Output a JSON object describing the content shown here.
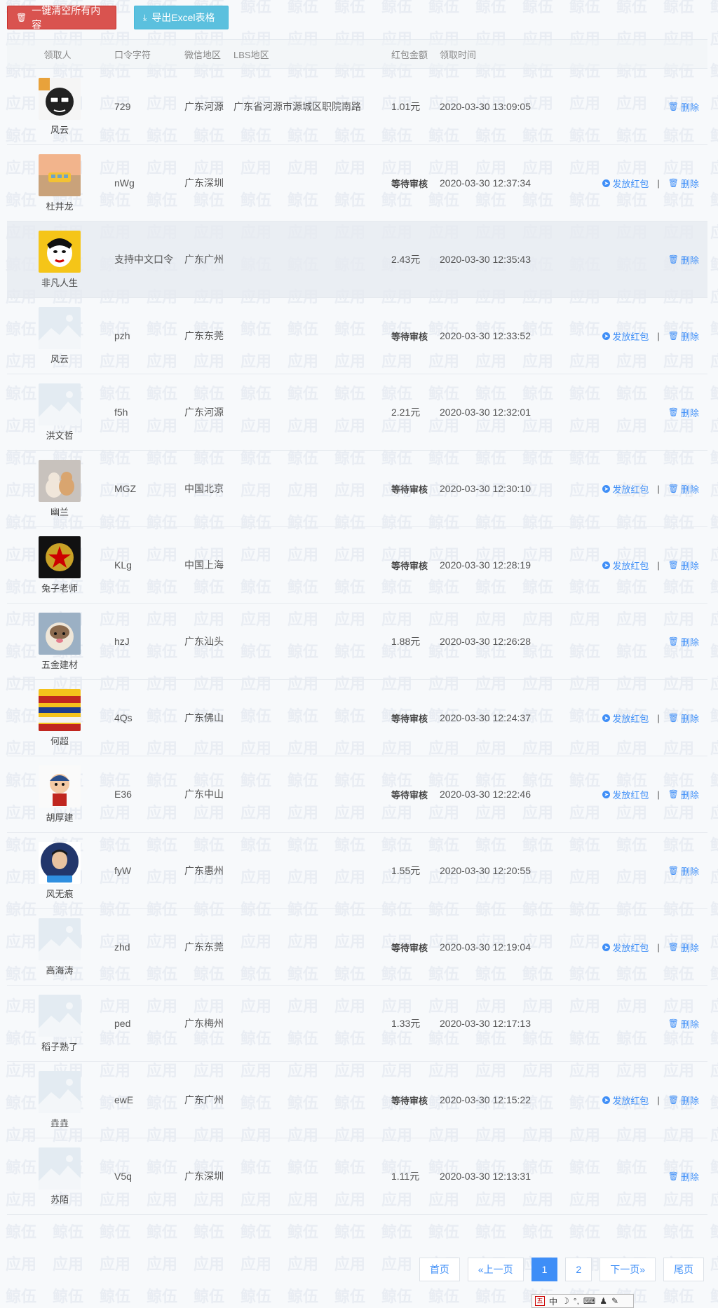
{
  "toolbar": {
    "clear_label": "一键清空所有内容",
    "clear_icon": "trash-icon",
    "export_label": "导出Excel表格",
    "export_icon": "download-icon"
  },
  "table": {
    "headers": {
      "user": "领取人",
      "code": "口令字符",
      "wx_region": "微信地区",
      "lbs_region": "LBS地区",
      "amount": "红包金额",
      "time": "领取时间"
    },
    "send_label": "发放红包",
    "delete_label": "删除",
    "separator": "|",
    "rows": [
      {
        "name": "风云",
        "code": "729",
        "wx": "广东河源",
        "lbs": "广东省河源市源城区职院南路",
        "amount": "1.01元",
        "pending": false,
        "time": "2020-03-30 13:09:05",
        "avatar": "glasses-cartoon"
      },
      {
        "name": "杜井龙",
        "code": "nWg",
        "wx": "广东深圳",
        "lbs": "",
        "amount": "等待审核",
        "pending": true,
        "time": "2020-03-30 12:37:34",
        "avatar": "sunset-bus"
      },
      {
        "name": "非凡人生",
        "code": "支持中文口令",
        "wx": "广东广州",
        "lbs": "",
        "amount": "2.43元",
        "pending": false,
        "time": "2020-03-30 12:35:43",
        "avatar": "opera-face"
      },
      {
        "name": "风云",
        "code": "pzh",
        "wx": "广东东莞",
        "lbs": "",
        "amount": "等待审核",
        "pending": true,
        "time": "2020-03-30 12:33:52",
        "avatar": "placeholder"
      },
      {
        "name": "洪文哲",
        "code": "f5h",
        "wx": "广东河源",
        "lbs": "",
        "amount": "2.21元",
        "pending": false,
        "time": "2020-03-30 12:32:01",
        "avatar": "placeholder"
      },
      {
        "name": "幽兰",
        "code": "MGZ",
        "wx": "中国北京",
        "lbs": "",
        "amount": "等待审核",
        "pending": true,
        "time": "2020-03-30 12:30:10",
        "avatar": "cats"
      },
      {
        "name": "兔子老师",
        "code": "KLg",
        "wx": "中国上海",
        "lbs": "",
        "amount": "等待审核",
        "pending": true,
        "time": "2020-03-30 12:28:19",
        "avatar": "emblem"
      },
      {
        "name": "五金建材",
        "code": "hzJ",
        "wx": "广东汕头",
        "lbs": "",
        "amount": "1.88元",
        "pending": false,
        "time": "2020-03-30 12:26:28",
        "avatar": "dog"
      },
      {
        "name": "何超",
        "code": "4Qs",
        "wx": "广东佛山",
        "lbs": "",
        "amount": "等待审核",
        "pending": true,
        "time": "2020-03-30 12:24:37",
        "avatar": "painting"
      },
      {
        "name": "胡厚建",
        "code": "E36",
        "wx": "广东中山",
        "lbs": "",
        "amount": "等待审核",
        "pending": true,
        "time": "2020-03-30 12:22:46",
        "avatar": "cartoon-boy"
      },
      {
        "name": "风无痕",
        "code": "fyW",
        "wx": "广东惠州",
        "lbs": "",
        "amount": "1.55元",
        "pending": false,
        "time": "2020-03-30 12:20:55",
        "avatar": "portrait"
      },
      {
        "name": "高海涛",
        "code": "zhd",
        "wx": "广东东莞",
        "lbs": "",
        "amount": "等待审核",
        "pending": true,
        "time": "2020-03-30 12:19:04",
        "avatar": "placeholder"
      },
      {
        "name": "稻子熟了",
        "code": "ped",
        "wx": "广东梅州",
        "lbs": "",
        "amount": "1.33元",
        "pending": false,
        "time": "2020-03-30 12:17:13",
        "avatar": "placeholder"
      },
      {
        "name": "垚垚",
        "code": "ewE",
        "wx": "广东广州",
        "lbs": "",
        "amount": "等待审核",
        "pending": true,
        "time": "2020-03-30 12:15:22",
        "avatar": "placeholder"
      },
      {
        "name": "苏陌",
        "code": "V5q",
        "wx": "广东深圳",
        "lbs": "",
        "amount": "1.11元",
        "pending": false,
        "time": "2020-03-30 12:13:31",
        "avatar": "placeholder"
      }
    ]
  },
  "pagination": {
    "first": "首页",
    "prev": "«上一页",
    "pages": [
      "1",
      "2"
    ],
    "current": "1",
    "next": "下一页»",
    "last": "尾页"
  },
  "ime_bar": {
    "logo": "五",
    "mode": "中"
  },
  "colors": {
    "danger": "#d9534f",
    "info": "#5bc0de",
    "link": "#3e8ef7"
  }
}
